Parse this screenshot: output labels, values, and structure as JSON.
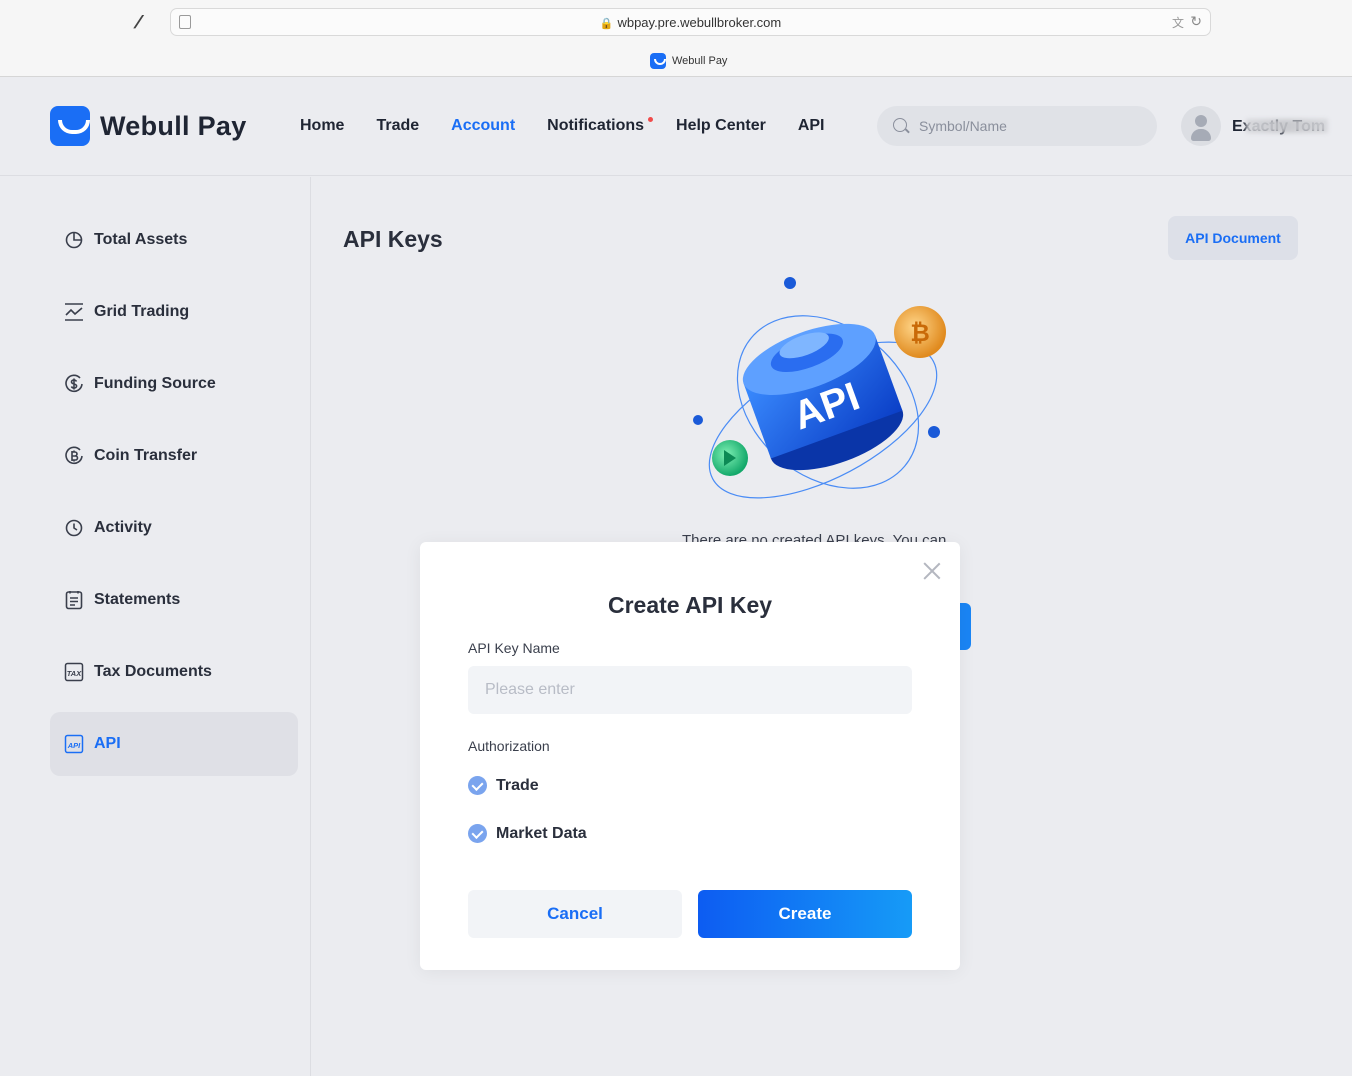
{
  "browser": {
    "url": "wbpay.pre.webullbroker.com",
    "tab_title": "Webull Pay"
  },
  "header": {
    "brand": "Webull Pay",
    "nav": [
      {
        "label": "Home"
      },
      {
        "label": "Trade"
      },
      {
        "label": "Account",
        "active": true
      },
      {
        "label": "Notifications",
        "badge": "dot"
      },
      {
        "label": "Help Center"
      },
      {
        "label": "API"
      }
    ],
    "search_placeholder": "Symbol/Name",
    "username": "Exactly Tom"
  },
  "sidebar": {
    "items": [
      {
        "label": "Total Assets",
        "icon": "pie-chart-icon"
      },
      {
        "label": "Grid Trading",
        "icon": "grid-trading-icon"
      },
      {
        "label": "Funding Source",
        "icon": "dollar-cycle-icon"
      },
      {
        "label": "Coin Transfer",
        "icon": "bitcoin-cycle-icon"
      },
      {
        "label": "Activity",
        "icon": "clock-icon"
      },
      {
        "label": "Statements",
        "icon": "document-icon"
      },
      {
        "label": "Tax Documents",
        "icon": "tax-icon"
      },
      {
        "label": "API",
        "icon": "api-icon",
        "active": true
      }
    ]
  },
  "main": {
    "title": "API Keys",
    "doc_button": "API Document",
    "empty_text": "There are no created API keys. You can"
  },
  "modal": {
    "title": "Create API Key",
    "name_label": "API Key Name",
    "name_placeholder": "Please enter",
    "authorization_label": "Authorization",
    "options": [
      {
        "label": "Trade",
        "checked": true
      },
      {
        "label": "Market Data",
        "checked": true
      }
    ],
    "cancel_label": "Cancel",
    "create_label": "Create"
  },
  "colors": {
    "accent": "#1a6ef5",
    "background": "#ebecf0",
    "notification_dot": "#f04b4b"
  }
}
